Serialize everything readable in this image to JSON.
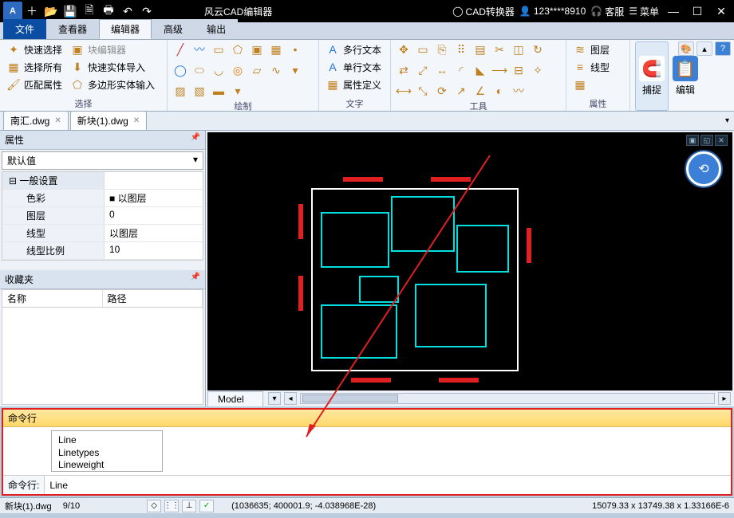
{
  "titlebar": {
    "app_title": "风云CAD编辑器",
    "convert": "CAD转换器",
    "user": "123****8910",
    "service": "客服",
    "menu": "菜单"
  },
  "tabs": {
    "file": "文件",
    "viewer": "查看器",
    "editor": "编辑器",
    "advanced": "高级",
    "output": "输出"
  },
  "ribbon": {
    "select_group": "选择",
    "quick_select": "快速选择",
    "select_all": "选择所有",
    "match_props": "匹配属性",
    "block_editor": "块编辑器",
    "quick_import": "快速实体导入",
    "poly_export": "多边形实体输入",
    "draw_group": "绘制",
    "text_group": "文字",
    "mtext": "多行文本",
    "stext": "单行文本",
    "attrdef": "属性定义",
    "tools_group": "工具",
    "props_group": "属性",
    "layer": "图层",
    "linetype": "线型",
    "snap": "捕捉",
    "edit": "编辑"
  },
  "filetabs": {
    "t1": "南汇.dwg",
    "t2": "新块(1).dwg"
  },
  "proppanel": {
    "title": "属性",
    "default": "默认值",
    "general": "一般设置",
    "color_k": "色彩",
    "color_v": "以图层",
    "layer_k": "图层",
    "layer_v": "0",
    "ltype_k": "线型",
    "ltype_v": "以图层",
    "lscale_k": "线型比例",
    "lscale_v": "10"
  },
  "favorites": {
    "title": "收藏夹",
    "name": "名称",
    "path": "路径"
  },
  "canvas": {
    "model_tab": "Model"
  },
  "cmd": {
    "title": "命令行",
    "sug1": "Line",
    "sug2": "Linetypes",
    "sug3": "Lineweight",
    "label": "命令行:",
    "value": "Line"
  },
  "status": {
    "file": "新块(1).dwg",
    "ratio": "9/10",
    "coord": "(1036635; 400001.9; -4.038968E-28)",
    "right": "15079.33 x 13749.38 x 1.33166E-6"
  }
}
